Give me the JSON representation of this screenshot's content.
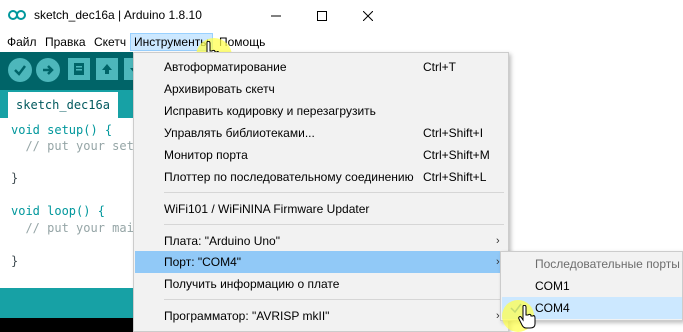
{
  "window": {
    "title": "sketch_dec16a | Arduino 1.8.10"
  },
  "menubar": {
    "items": [
      {
        "label": "Файл"
      },
      {
        "label": "Правка"
      },
      {
        "label": "Скетч"
      },
      {
        "label": "Инструменты"
      },
      {
        "label": "Помощь"
      }
    ]
  },
  "toolbar": {
    "buttons": [
      "verify-icon",
      "upload-icon",
      "new-icon",
      "open-icon",
      "save-icon"
    ]
  },
  "editor": {
    "tab_label": "sketch_dec16a",
    "lines": [
      "void setup() {",
      "  // put your setup code here, to run once:",
      "",
      "}",
      "",
      "void loop() {",
      "  // put your main code here, to run repeatedly:",
      "",
      "}"
    ]
  },
  "tools_menu": {
    "items": [
      {
        "label": "Автоформатирование",
        "shortcut": "Ctrl+T"
      },
      {
        "label": "Архивировать скетч",
        "shortcut": ""
      },
      {
        "label": "Исправить кодировку и перезагрузить",
        "shortcut": ""
      },
      {
        "label": "Управлять библиотеками...",
        "shortcut": "Ctrl+Shift+I"
      },
      {
        "label": "Монитор порта",
        "shortcut": "Ctrl+Shift+M"
      },
      {
        "label": "Плоттер по последовательному соединению",
        "shortcut": "Ctrl+Shift+L"
      },
      {
        "label": "WiFi101 / WiFiNINA Firmware Updater",
        "shortcut": ""
      },
      {
        "label": "Плата: \"Arduino Uno\"",
        "shortcut": ""
      },
      {
        "label": "Порт: \"COM4\"",
        "shortcut": ""
      },
      {
        "label": "Получить информацию о плате",
        "shortcut": ""
      },
      {
        "label": "Программатор: \"AVRISP mkII\"",
        "shortcut": ""
      }
    ]
  },
  "port_submenu": {
    "header": "Последовательные порты",
    "items": [
      {
        "label": "COM1",
        "selected": false
      },
      {
        "label": "COM4",
        "selected": true
      }
    ]
  },
  "colors": {
    "toolbar_bg": "#006468",
    "tabstrip_bg": "#17a1a5",
    "menu_highlight": "#91c9f7",
    "submenu_highlight": "#cce8ff",
    "keyword": "#00979c"
  }
}
